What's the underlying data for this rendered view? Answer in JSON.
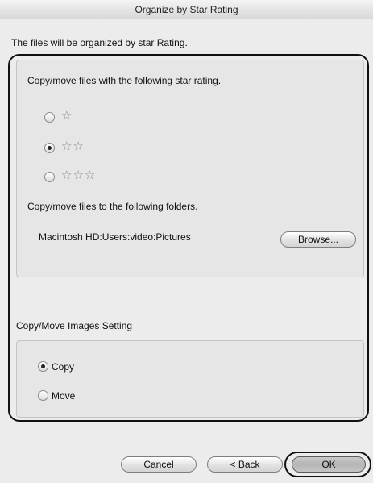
{
  "window": {
    "title": "Organize by Star Rating"
  },
  "description": "The files will be organized by star Rating.",
  "rating_section": {
    "label": "Copy/move files with the following star rating.",
    "options": [
      {
        "stars": "☆",
        "selected": false
      },
      {
        "stars": "☆☆",
        "selected": true
      },
      {
        "stars": "☆☆☆",
        "selected": false
      }
    ]
  },
  "folder_section": {
    "label": "Copy/move files to the following folders.",
    "path": "Macintosh HD:Users:video:Pictures",
    "browse_label": "Browse..."
  },
  "images_setting": {
    "label": "Copy/Move Images Setting",
    "options": [
      {
        "label": "Copy",
        "selected": true
      },
      {
        "label": "Move",
        "selected": false
      }
    ]
  },
  "buttons": {
    "cancel": "Cancel",
    "back": "< Back",
    "ok": "OK"
  },
  "colors": {
    "window_bg": "#ececec",
    "highlight_outline": "#111111"
  }
}
